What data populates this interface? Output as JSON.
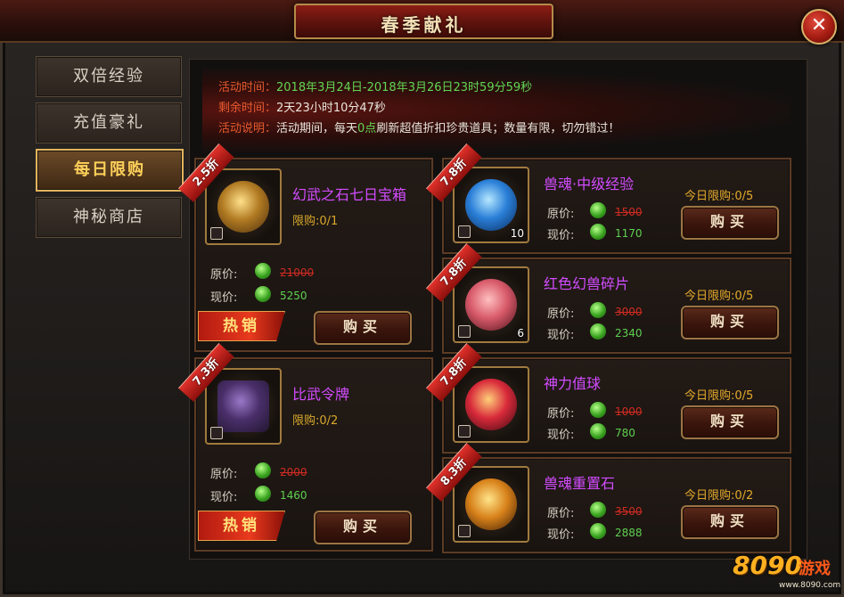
{
  "window": {
    "title": "春季献礼",
    "close_label": "✕"
  },
  "tabs": [
    {
      "label": "双倍经验",
      "active": false
    },
    {
      "label": "充值豪礼",
      "active": false
    },
    {
      "label": "每日限购",
      "active": true
    },
    {
      "label": "神秘商店",
      "active": false
    }
  ],
  "info": {
    "time_label": "活动时间：",
    "time_value": "2018年3月24日-2018年3月26日23时59分59秒",
    "remain_label": "剩余时间：",
    "remain_value": "2天23小时10分47秒",
    "desc_label": "活动说明：",
    "desc_pre": "活动期间，每天",
    "desc_hl": "0点",
    "desc_post": "刷新超值折扣珍贵道具；数量有限，切勿错过！"
  },
  "labels": {
    "orig_price": "原价:",
    "cur_price": "现价:",
    "buy": "购买",
    "hot": "热销"
  },
  "big_items": [
    {
      "discount": "2.5折",
      "name": "幻武之石七日宝箱",
      "limit": "限购:0/1",
      "old_price": "21000",
      "new_price": "5250",
      "hot": true,
      "icon": "treasure-chest-icon"
    },
    {
      "discount": "7.3折",
      "name": "比武令牌",
      "limit": "限购:0/2",
      "old_price": "2000",
      "new_price": "1460",
      "hot": true,
      "icon": "token-icon"
    }
  ],
  "small_items": [
    {
      "discount": "7.8折",
      "name": "兽魂·中级经验",
      "today": "今日限购:0/5",
      "old_price": "1500",
      "new_price": "1170",
      "count": "10",
      "icon": "exp-orb-icon"
    },
    {
      "discount": "7.8折",
      "name": "红色幻兽碎片",
      "today": "今日限购:0/5",
      "old_price": "3000",
      "new_price": "2340",
      "count": "6",
      "icon": "red-lotus-icon"
    },
    {
      "discount": "7.8折",
      "name": "神力值球",
      "today": "今日限购:0/5",
      "old_price": "1000",
      "new_price": "780",
      "count": "",
      "icon": "power-orb-icon"
    },
    {
      "discount": "8.3折",
      "name": "兽魂重置石",
      "today": "今日限购:0/2",
      "old_price": "3500",
      "new_price": "2888",
      "count": "",
      "icon": "reset-stone-icon"
    }
  ],
  "watermark": {
    "num": "8090",
    "text": "游戏",
    "url": "www.8090.com"
  },
  "colors": {
    "accent_gold": "#e2b35b",
    "name_purple": "#d34cff",
    "price_green": "#5ed050",
    "old_price_red": "#d12b22"
  }
}
